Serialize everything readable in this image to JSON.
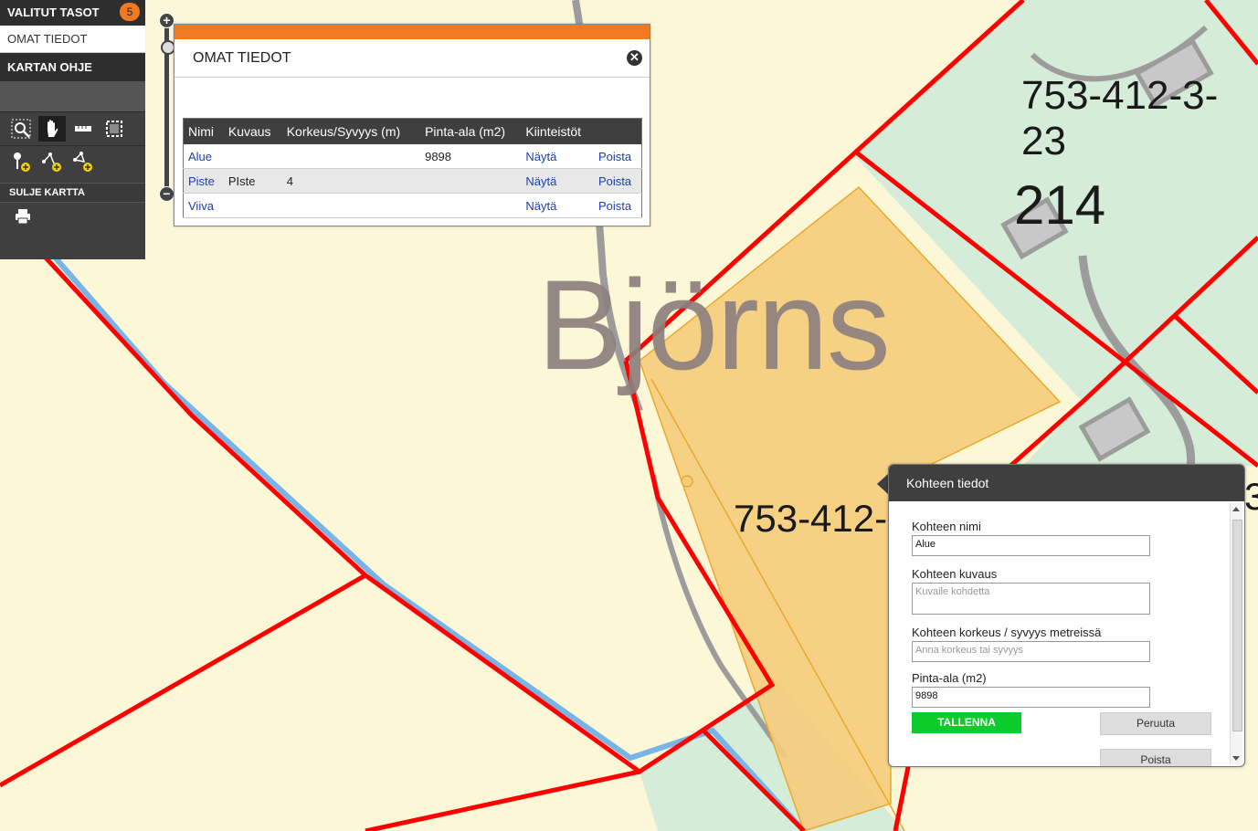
{
  "sidebar": {
    "selected_layers_label": "VALITUT TASOT",
    "selected_layers_count": "5",
    "my_data_label": "OMAT TIEDOT",
    "map_help_label": "KARTAN OHJE",
    "tools": [
      "zoom-box-icon",
      "pan-hand-icon",
      "measure-ruler-icon",
      "select-area-icon"
    ],
    "draw_tools": [
      "add-point-icon",
      "add-line-icon",
      "add-area-icon"
    ],
    "close_map_label": "SULJE KARTTA",
    "print_icon": "printer-icon"
  },
  "zoom": {
    "plus": "+",
    "minus": "−"
  },
  "omat_window": {
    "title": "OMAT TIEDOT",
    "close_symbol": "✕",
    "headers": [
      "Nimi",
      "Kuvaus",
      "Korkeus/Syvyys (m)",
      "Pinta-ala (m2)",
      "Kiinteistöt",
      ""
    ],
    "rows": [
      {
        "nimi": "Alue",
        "kuvaus": "",
        "korkeus": "",
        "pinta_ala": "9898",
        "kiinteistot": "Näytä",
        "action": "Poista"
      },
      {
        "nimi": "Piste",
        "kuvaus": "PIste",
        "korkeus": "4",
        "pinta_ala": "",
        "kiinteistot": "Näytä",
        "action": "Poista"
      },
      {
        "nimi": "Viiva",
        "kuvaus": "",
        "korkeus": "",
        "pinta_ala": "",
        "kiinteistot": "Näytä",
        "action": "Poista"
      }
    ]
  },
  "map": {
    "place_name": "Björns",
    "parcel_label_1": "753-412-3-23",
    "parcel_label_2": "753-412-",
    "parcel_label_3": "214",
    "edge_fragment": "3"
  },
  "kohde_popup": {
    "title": "Kohteen tiedot",
    "name_label": "Kohteen nimi",
    "name_value": "Alue",
    "desc_label": "Kohteen kuvaus",
    "desc_placeholder": "Kuvaile kohdetta",
    "height_label": "Kohteen korkeus / syvyys metreissä",
    "height_placeholder": "Anna korkeus tai syvyys",
    "area_label": "Pinta-ala (m2)",
    "area_value": "9898",
    "save_label": "TALLENNA",
    "cancel_label": "Peruuta",
    "delete_label": "Poista"
  },
  "colors": {
    "accent_orange": "#f07a1f",
    "parcel_red": "#ff0000",
    "drawn_area_fill": "#f5cc7a",
    "save_green": "#0ccc2c",
    "link_blue": "#1a3fb3",
    "dark_panel": "#3f3f3f"
  }
}
